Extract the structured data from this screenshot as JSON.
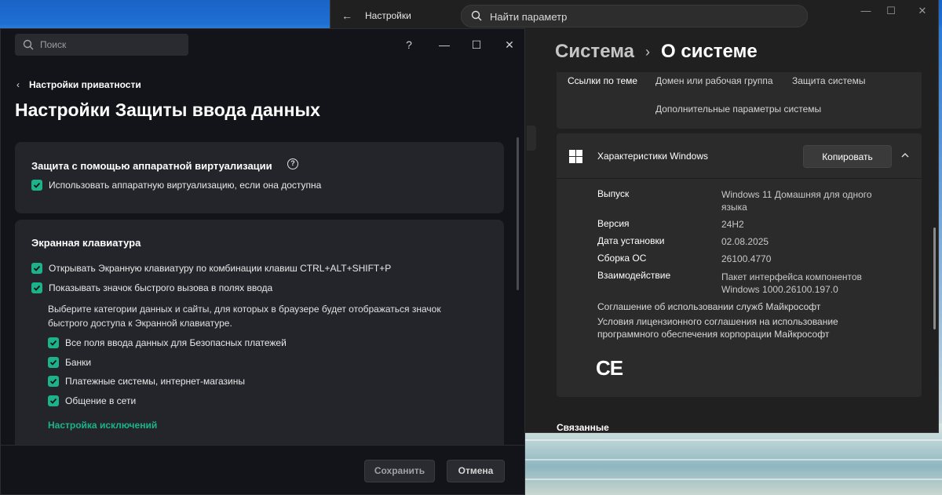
{
  "settings_window": {
    "app_title": "Настройки",
    "search_placeholder": "Найти параметр",
    "breadcrumb": {
      "parent": "Система",
      "separator": "›",
      "current": "О системе"
    },
    "related_links": {
      "label": "Ссылки по теме",
      "links": [
        "Домен или рабочая группа",
        "Защита системы",
        "Дополнительные параметры системы"
      ]
    },
    "windows_specs": {
      "title": "Характеристики Windows",
      "copy_button": "Копировать",
      "rows": [
        {
          "label": "Выпуск",
          "value": "Windows 11 Домашняя для одного языка"
        },
        {
          "label": "Версия",
          "value": "24H2"
        },
        {
          "label": "Дата установки",
          "value": "02.08.2025"
        },
        {
          "label": "Сборка ОС",
          "value": "26100.4770"
        },
        {
          "label": "Взаимодействие",
          "value": "Пакет интерфейса компонентов Windows 1000.26100.197.0"
        }
      ],
      "links": [
        "Соглашение об использовании служб Майкрософт",
        "Условия лицензионного соглашения на использование программного обеспечения корпорации Майкрософт"
      ],
      "ce_mark": "CE"
    },
    "related_section": "Связанные"
  },
  "kaspersky_window": {
    "search_placeholder": "Поиск",
    "controls": {
      "help": "?",
      "minimize": "—",
      "maximize": "☐",
      "close": "✕"
    },
    "back_link": "Настройки приватности",
    "page_title": "Настройки Защиты ввода данных",
    "hw_virtualization": {
      "heading": "Защита с помощью аппаратной виртуализации",
      "checkbox": "Использовать аппаратную виртуализацию, если она доступна"
    },
    "onscreen_keyboard": {
      "heading": "Экранная клавиатура",
      "checkbox_open": "Открывать Экранную клавиатуру по комбинации клавиш CTRL+ALT+SHIFT+P",
      "checkbox_show_icon": "Показывать значок быстрого вызова в полях ввода",
      "description": "Выберите категории данных и сайты, для которых в браузере будет отображаться значок быстрого доступа к Экранной клавиатуре.",
      "categories": [
        "Все поля ввода данных для Безопасных платежей",
        "Банки",
        "Платежные системы, интернет-магазины",
        "Общение в сети"
      ],
      "exceptions_link": "Настройка исключений"
    },
    "footer": {
      "save": "Сохранить",
      "cancel": "Отмена"
    }
  },
  "colors": {
    "accent_green": "#1cb38b",
    "kaspersky_bg": "#131419",
    "settings_bg": "#202020"
  }
}
